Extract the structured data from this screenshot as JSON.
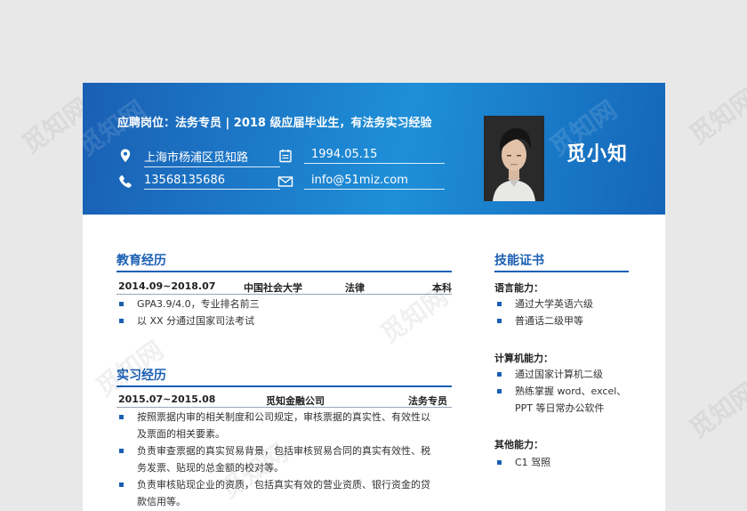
{
  "header": {
    "title": "应聘岗位：法务专员 | 2018 级应届毕业生，有法务实习经验",
    "name": "觅小知",
    "address": "上海市杨浦区觅知路",
    "phone": "13568135686",
    "birthday": "1994.05.15",
    "email": "info@51miz.com"
  },
  "education": {
    "title": "教育经历",
    "period": "2014.09~2018.07",
    "school": "中国社会大学",
    "major": "法律",
    "degree": "本科",
    "items": [
      "GPA3.9/4.0，专业排名前三",
      "以 XX 分通过国家司法考试"
    ]
  },
  "internship": {
    "title": "实习经历",
    "period": "2015.07~2015.08",
    "company": "觅知金融公司",
    "role": "法务专员",
    "items": [
      [
        "按照票据内审的相关制度和公司规定，审核票据的真实性、有效性以",
        "及票面的相关要素。"
      ],
      [
        "负责审查票据的真实贸易背景，包括审核贸易合同的真实有效性、税",
        "务发票、贴现的总金额的校对等。"
      ],
      [
        "负责审核贴现企业的资质，包括真实有效的营业资质、银行资金的贷",
        "款信用等。"
      ]
    ]
  },
  "skills": {
    "title": "技能证书",
    "language_label": "语言能力：",
    "language": [
      "通过大学英语六级",
      "普通话二级甲等"
    ],
    "computer_label": "计算机能力：",
    "computer": [
      [
        "通过国家计算机二级"
      ],
      [
        "熟练掌握 word、excel、",
        "PPT 等日常办公软件"
      ]
    ],
    "other_label": "其他能力：",
    "other": [
      "C1 驾照"
    ]
  },
  "watermark": "觅知网",
  "colors": {
    "accent": "#1a5fb4",
    "header_light": "#1e8fd8"
  }
}
